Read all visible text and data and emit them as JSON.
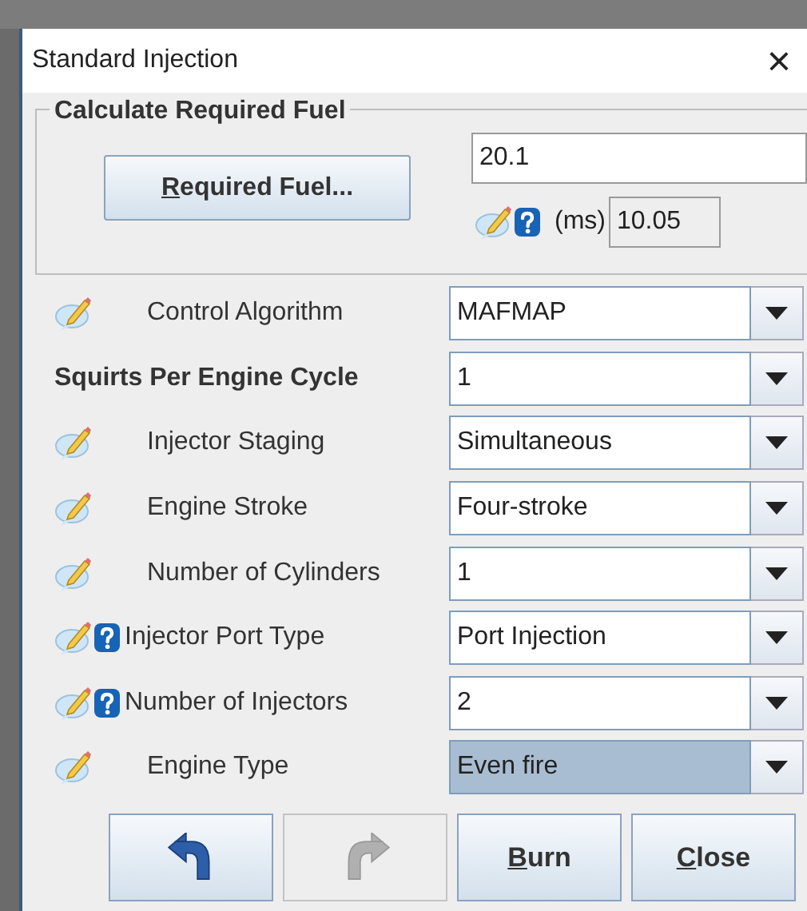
{
  "window": {
    "title": "Standard Injection",
    "close": "×"
  },
  "required_fuel": {
    "group_title": "Calculate Required Fuel",
    "button": {
      "label": "Required Fuel...",
      "underlined_first": true
    },
    "value": "20.1",
    "unit": "(ms)",
    "result": "10.05",
    "edit_icon": true,
    "help_icon": true
  },
  "rows": [
    {
      "label": "Control Algorithm",
      "value": "MAFMAP",
      "edit_icon": true,
      "help_icon": false,
      "bold": false,
      "highlighted": false
    },
    {
      "label": "Squirts Per Engine Cycle",
      "value": "1",
      "edit_icon": false,
      "help_icon": false,
      "bold": true,
      "highlighted": false
    },
    {
      "label": "Injector Staging",
      "value": "Simultaneous",
      "edit_icon": true,
      "help_icon": false,
      "bold": false,
      "highlighted": false
    },
    {
      "label": "Engine Stroke",
      "value": "Four-stroke",
      "edit_icon": true,
      "help_icon": false,
      "bold": false,
      "highlighted": false
    },
    {
      "label": "Number of Cylinders",
      "value": "1",
      "edit_icon": true,
      "help_icon": false,
      "bold": false,
      "highlighted": false
    },
    {
      "label": "Injector Port Type",
      "value": "Port Injection",
      "edit_icon": true,
      "help_icon": true,
      "bold": false,
      "highlighted": false
    },
    {
      "label": "Number of Injectors",
      "value": "2",
      "edit_icon": true,
      "help_icon": true,
      "bold": false,
      "highlighted": false
    },
    {
      "label": "Engine Type",
      "value": "Even fire",
      "edit_icon": true,
      "help_icon": false,
      "bold": false,
      "highlighted": true
    }
  ],
  "buttons": [
    {
      "kind": "undo",
      "disabled": false
    },
    {
      "kind": "redo",
      "disabled": true
    },
    {
      "kind": "text",
      "label": "Burn",
      "underlined_first": true,
      "disabled": false
    },
    {
      "kind": "text",
      "label": "Close",
      "underlined_first": true,
      "disabled": false
    }
  ]
}
